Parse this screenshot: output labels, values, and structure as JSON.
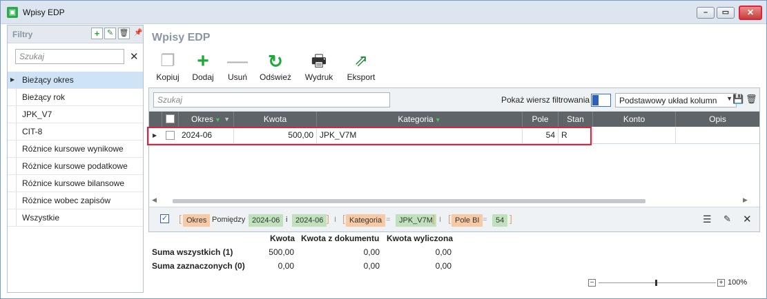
{
  "window": {
    "title": "Wpisy EDP"
  },
  "filters": {
    "title": "Filtry",
    "search_placeholder": "Szukaj",
    "items": [
      "Bieżący okres",
      "Bieżący rok",
      "JPK_V7",
      "CIT-8",
      "Różnice kursowe wynikowe",
      "Różnice kursowe podatkowe",
      "Różnice kursowe bilansowe",
      "Różnice wobec zapisów",
      "Wszystkie"
    ],
    "selected_index": 0
  },
  "main": {
    "title": "Wpisy EDP",
    "toolbar": {
      "copy": "Kopiuj",
      "add": "Dodaj",
      "remove": "Usuń",
      "refresh": "Odśwież",
      "print": "Wydruk",
      "export": "Eksport"
    }
  },
  "grid": {
    "search_placeholder": "Szukaj",
    "show_filter_row_label": "Pokaż wiersz filtrowania",
    "layout_value": "Podstawowy układ kolumn",
    "columns": [
      "Okres",
      "Kwota",
      "Kategoria",
      "Pole",
      "Stan",
      "Konto",
      "Opis"
    ],
    "rows": [
      {
        "okres": "2024-06",
        "kwota": "500,00",
        "kategoria": "JPK_V7M",
        "pole": "54",
        "stan": "R",
        "konto": "",
        "opis": ""
      }
    ]
  },
  "filter_bar": {
    "okres_field": "Okres",
    "between": "Pomiędzy",
    "from": "2024-06",
    "and": "i",
    "to": "2024-06",
    "sep": "I",
    "kategoria_field": "Kategoria",
    "eq": "=",
    "kategoria_value": "JPK_V7M",
    "pole_field": "Pole BI",
    "pole_value": "54"
  },
  "sums": {
    "headers": [
      "Kwota",
      "Kwota z dokumentu",
      "Kwota wyliczona"
    ],
    "rows": [
      {
        "label": "Suma wszystkich (1)",
        "values": [
          "500,00",
          "0,00",
          "0,00"
        ]
      },
      {
        "label": "Suma zaznaczonych (0)",
        "values": [
          "0,00",
          "0,00",
          "0,00"
        ]
      }
    ]
  },
  "zoom": {
    "level": "100%"
  },
  "colors": {
    "accent_green": "#1fa83a",
    "highlight_red": "#e0203c",
    "header_gray": "#5f6468",
    "selection_blue": "#cfe3f7"
  }
}
